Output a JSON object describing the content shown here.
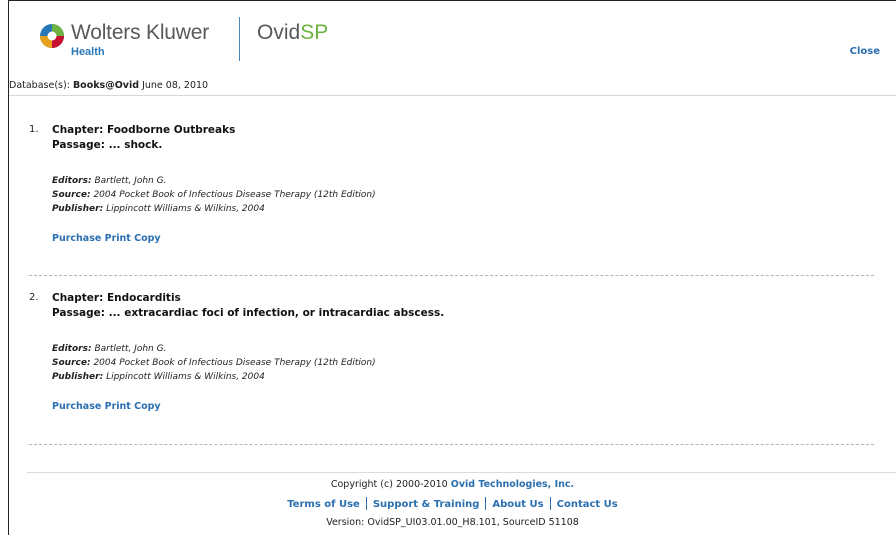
{
  "header": {
    "brand_name": "Wolters Kluwer",
    "brand_sub": "Health",
    "product_main": "Ovid",
    "product_accent": "SP",
    "close_label": "Close"
  },
  "database": {
    "prefix": "Database(s):",
    "name": "Books@Ovid",
    "date": "June 08, 2010"
  },
  "results": [
    {
      "number": "1.",
      "chapter": "Chapter: Foodborne Outbreaks",
      "passage": "Passage: ... shock.",
      "editors_label": "Editors:",
      "editors": "Bartlett, John G.",
      "source_label": "Source:",
      "source": "2004 Pocket Book of Infectious Disease Therapy (12th Edition)",
      "publisher_label": "Publisher:",
      "publisher": "Lippincott Williams & Wilkins, 2004",
      "purchase_label": "Purchase Print Copy"
    },
    {
      "number": "2.",
      "chapter": "Chapter: Endocarditis",
      "passage": "Passage: ... extracardiac foci of infection, or intracardiac abscess.",
      "editors_label": "Editors:",
      "editors": "Bartlett, John G.",
      "source_label": "Source:",
      "source": "2004 Pocket Book of Infectious Disease Therapy (12th Edition)",
      "publisher_label": "Publisher:",
      "publisher": "Lippincott Williams & Wilkins, 2004",
      "purchase_label": "Purchase Print Copy"
    }
  ],
  "footer": {
    "copyright_prefix": "Copyright (c) 2000-2010",
    "copyright_company": "Ovid Technologies, Inc.",
    "links": [
      "Terms of Use",
      "Support & Training",
      "About Us",
      "Contact Us"
    ],
    "version": "Version: OvidSP_UI03.01.00_H8.101, SourceID 51108"
  },
  "colors": {
    "link": "#2a6fb0",
    "brand_blue": "#2a77b6",
    "brand_green": "#6cb33f",
    "logo_text": "#595959"
  }
}
